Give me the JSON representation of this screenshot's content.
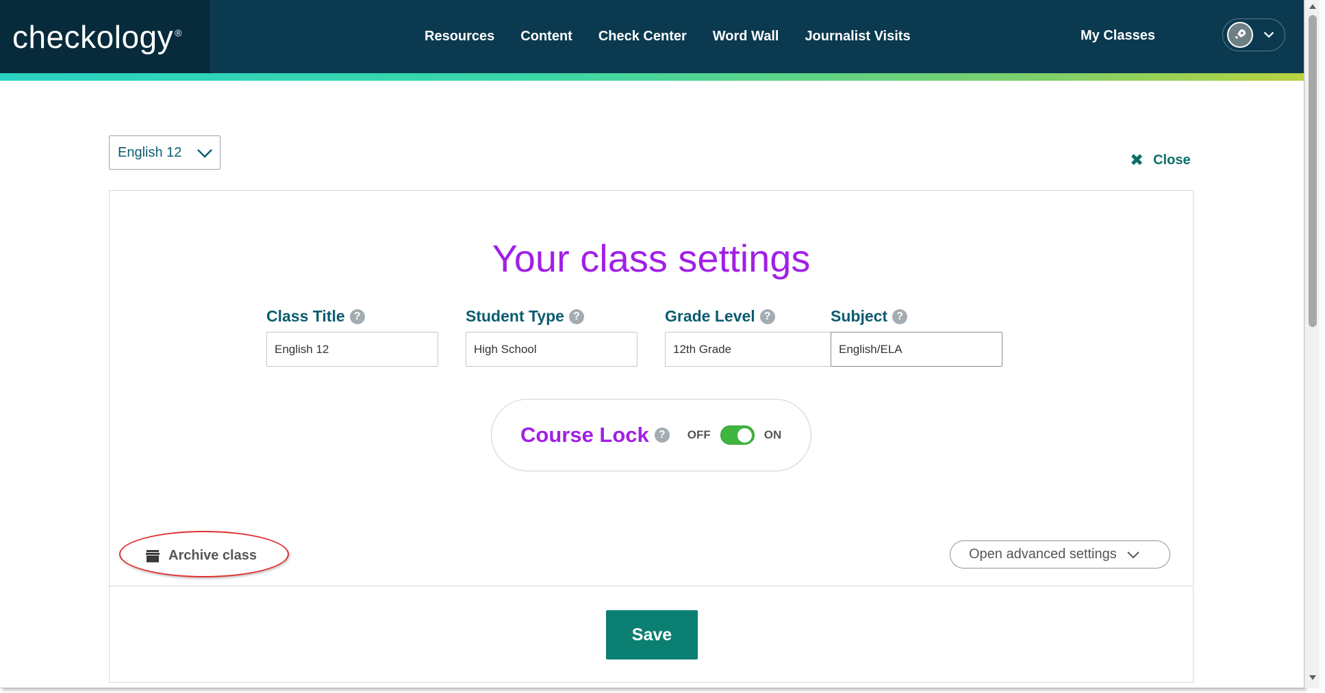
{
  "header": {
    "logo_text": "checkology",
    "logo_mark": "®",
    "nav": [
      "Resources",
      "Content",
      "Check Center",
      "Word Wall",
      "Journalist Visits"
    ],
    "my_classes": "My Classes",
    "user_avatar_icon": "rocket-icon"
  },
  "class_selector": {
    "value": "English 12"
  },
  "close": {
    "label": "Close"
  },
  "settings": {
    "title": "Your class settings",
    "fields": [
      {
        "label": "Class Title",
        "value": "English 12"
      },
      {
        "label": "Student Type",
        "value": "High School"
      },
      {
        "label": "Grade Level",
        "value": "12th Grade"
      },
      {
        "label": "Subject",
        "value": "English/ELA"
      }
    ],
    "help_glyph": "?",
    "course_lock": {
      "label": "Course Lock",
      "off_label": "OFF",
      "on_label": "ON",
      "state": "on"
    },
    "archive": {
      "label": "Archive class"
    },
    "advanced": {
      "label": "Open advanced settings"
    },
    "save_label": "Save"
  },
  "colors": {
    "header_bg": "#0b3a50",
    "accent_teal": "#0b7f72",
    "title_purple": "#a020e6",
    "toggle_green": "#3fb53f",
    "highlight_red": "#e02e2e"
  }
}
